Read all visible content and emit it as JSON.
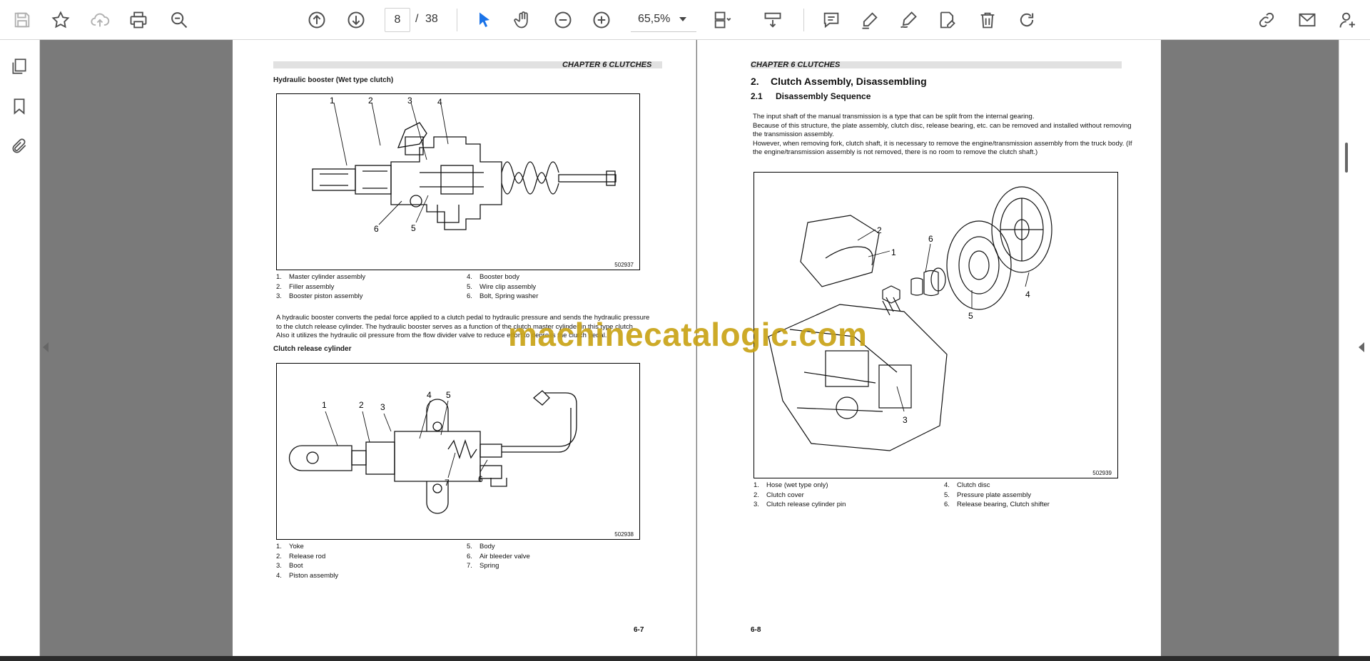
{
  "toolbar": {
    "current_page": "8",
    "page_separator": "/",
    "total_pages": "38",
    "zoom": "65,5%"
  },
  "left_page": {
    "chapter_header": "CHAPTER 6 CLUTCHES",
    "section1_title": "Hydraulic booster (Wet type clutch)",
    "figure1": {
      "code": "502937",
      "callouts": [
        "1",
        "2",
        "3",
        "4",
        "5",
        "6"
      ]
    },
    "legend1": [
      {
        "n": "1.",
        "label": "Master cylinder assembly"
      },
      {
        "n": "2.",
        "label": "Filler assembly"
      },
      {
        "n": "3.",
        "label": "Booster piston assembly"
      },
      {
        "n": "4.",
        "label": "Booster body"
      },
      {
        "n": "5.",
        "label": "Wire clip assembly"
      },
      {
        "n": "6.",
        "label": "Bolt, Spring washer"
      }
    ],
    "paragraph_lines": [
      "A hydraulic booster converts the pedal force applied to a clutch pedal to hydraulic pressure and sends the hydraulic pressure",
      "to the clutch release cylinder. The hydraulic booster serves as a function of the clutch master cylinder in this type clutch.",
      "Also it utilizes the hydraulic oil pressure from the flow divider valve to reduce effort to depress the clutch pedal."
    ],
    "section2_title": "Clutch release cylinder",
    "figure2": {
      "code": "502938",
      "callouts": [
        "1",
        "2",
        "3",
        "4",
        "5",
        "6",
        "7"
      ]
    },
    "legend2": [
      {
        "n": "1.",
        "label": "Yoke"
      },
      {
        "n": "2.",
        "label": "Release rod"
      },
      {
        "n": "3.",
        "label": "Boot"
      },
      {
        "n": "4.",
        "label": "Piston assembly"
      },
      {
        "n": "5.",
        "label": "Body"
      },
      {
        "n": "6.",
        "label": "Air bleeder valve"
      },
      {
        "n": "7.",
        "label": "Spring"
      }
    ],
    "page_number": "6-7"
  },
  "right_page": {
    "chapter_header": "CHAPTER 6 CLUTCHES",
    "heading_num": "2.",
    "heading": "Clutch Assembly, Disassembling",
    "subheading_num": "2.1",
    "subheading": "Disassembly Sequence",
    "paragraph_lines": [
      "The input shaft of the manual transmission is a type that can be split from the internal gearing.",
      "Because of this structure, the plate assembly, clutch disc, release bearing, etc. can be removed and installed without removing",
      "the transmission assembly.",
      "However, when removing fork, clutch shaft, it is necessary to remove the engine/transmission assembly from the truck body. (If",
      "the engine/transmission assembly is not removed, there is no room to remove the clutch shaft.)"
    ],
    "figure3": {
      "code": "502939",
      "callouts": [
        "1",
        "2",
        "3",
        "4",
        "5",
        "6"
      ]
    },
    "legend3": [
      {
        "n": "1.",
        "label": "Hose (wet type only)"
      },
      {
        "n": "2.",
        "label": "Clutch cover"
      },
      {
        "n": "3.",
        "label": "Clutch release cylinder pin"
      },
      {
        "n": "4.",
        "label": "Clutch disc"
      },
      {
        "n": "5.",
        "label": "Pressure plate assembly"
      },
      {
        "n": "6.",
        "label": "Release bearing, Clutch shifter"
      }
    ],
    "page_number": "6-8"
  },
  "watermark": "machinecatalogic.com",
  "icons": {
    "toolbar": [
      "save-icon",
      "star-icon",
      "upload-cloud-icon",
      "print-icon",
      "zoom-search-icon",
      "page-up-icon",
      "page-down-icon",
      "select-cursor-icon",
      "hand-icon",
      "zoom-out-icon",
      "zoom-in-icon",
      "page-layout-icon",
      "scroll-mode-icon",
      "comment-icon",
      "highlight-pen-icon",
      "draw-icon",
      "sign-icon",
      "delete-icon",
      "rotate-icon",
      "share-link-icon",
      "email-icon",
      "add-user-icon"
    ],
    "leftnav": [
      "page-thumbnails-icon",
      "bookmark-icon",
      "attachment-icon"
    ]
  }
}
